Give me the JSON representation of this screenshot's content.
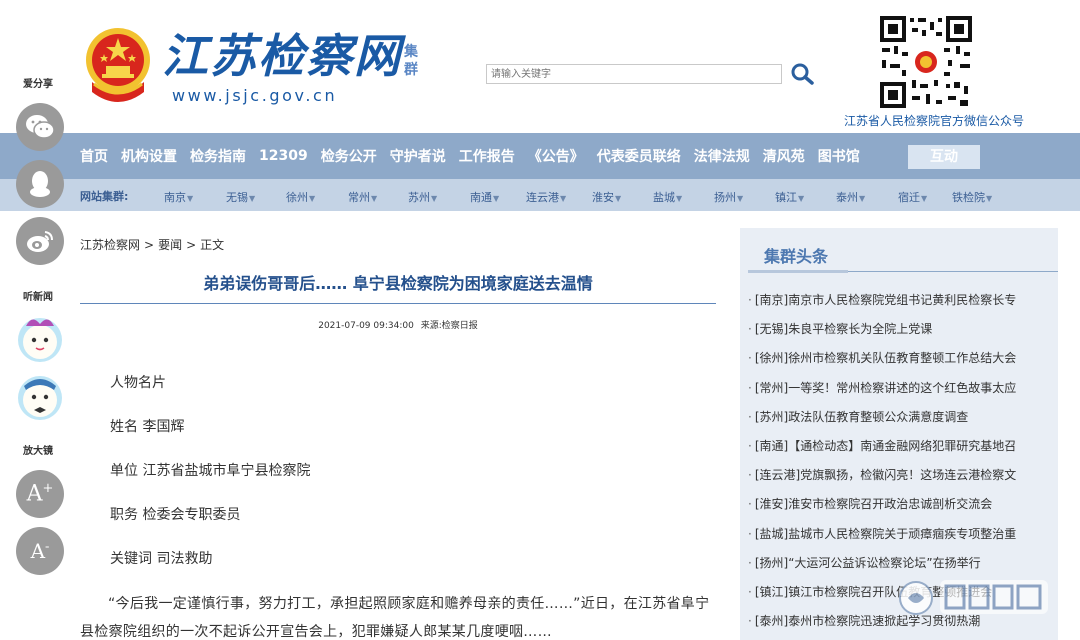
{
  "header": {
    "site_title": "江苏检察网",
    "site_url": "www.jsjc.gov.cn",
    "tag": "集群",
    "search_placeholder": "请输入关键字",
    "qr_caption": "江苏省人民检察院官方微信公众号"
  },
  "nav": {
    "main": [
      "首页",
      "机构设置",
      "检务指南",
      "12309",
      "检务公开",
      "守护者说",
      "工作报告",
      "《公告》",
      "代表委员联络",
      "法律法规",
      "清风苑",
      "图书馆"
    ],
    "interact": "互动",
    "sub_label": "网站集群:",
    "cities": [
      "南京",
      "无锡",
      "徐州",
      "常州",
      "苏州",
      "南通",
      "连云港",
      "淮安",
      "盐城",
      "扬州",
      "镇江",
      "泰州",
      "宿迁",
      "铁检院"
    ]
  },
  "share": {
    "share_label": "爱分享",
    "listen_label": "听新闻",
    "zoom_label": "放大镜",
    "zoom_in": "A",
    "zoom_in_sup": "+",
    "zoom_out": "A",
    "zoom_out_sup": "-"
  },
  "breadcrumb": [
    "江苏检察网",
    "要闻",
    "正文"
  ],
  "breadcrumb_sep": ">",
  "article": {
    "title": "弟弟误伤哥哥后…… 阜宁县检察院为困境家庭送去温情",
    "date": "2021-07-09 09:34:00",
    "source": "来源:检察日报",
    "profile_heading": "人物名片",
    "name_line": "姓名 李国辉",
    "unit_line": "单位 江苏省盐城市阜宁县检察院",
    "post_line": "职务 检委会专职委员",
    "keyword_line": "关键词 司法救助",
    "body": "“今后我一定谨慎行事，努力打工，承担起照顾家庭和赡养母亲的责任……”近日，在江苏省阜宁县检察院组织的一次不起诉公开宣告会上，犯罪嫌疑人郎某某几度哽咽……"
  },
  "sidebar": {
    "title": "集群头条",
    "bullet": "·",
    "items": [
      "[南京]南京市人民检察院党组书记黄利民检察长专",
      "[无锡]朱良平检察长为全院上党课",
      "[徐州]徐州市检察机关队伍教育整顿工作总结大会",
      "[常州]一等奖！常州检察讲述的这个红色故事太应",
      "[苏州]政法队伍教育整顿公众满意度调查",
      "[南通]【通检动态】南通金融网络犯罪研究基地召",
      "[连云港]党旗飘扬，检徽闪亮！这场连云港检察文",
      "[淮安]淮安市检察院召开政治忠诚剖析交流会",
      "[盐城]盐城市人民检察院关于顽瘴痼疾专项整治重",
      "[扬州]“大运河公益诉讼检察论坛”在扬举行",
      "[镇江]镇江市检察院召开队伍教育整顿推进会",
      "[泰州]泰州市检察院迅速掀起学习贯彻热潮"
    ]
  },
  "colors": {
    "brand_blue": "#1a5aa5",
    "nav_blue": "#8ea9c9",
    "subnav_blue": "#c4d3e5",
    "title_blue": "#24508c",
    "sidebar_bg": "#e9eef5"
  }
}
